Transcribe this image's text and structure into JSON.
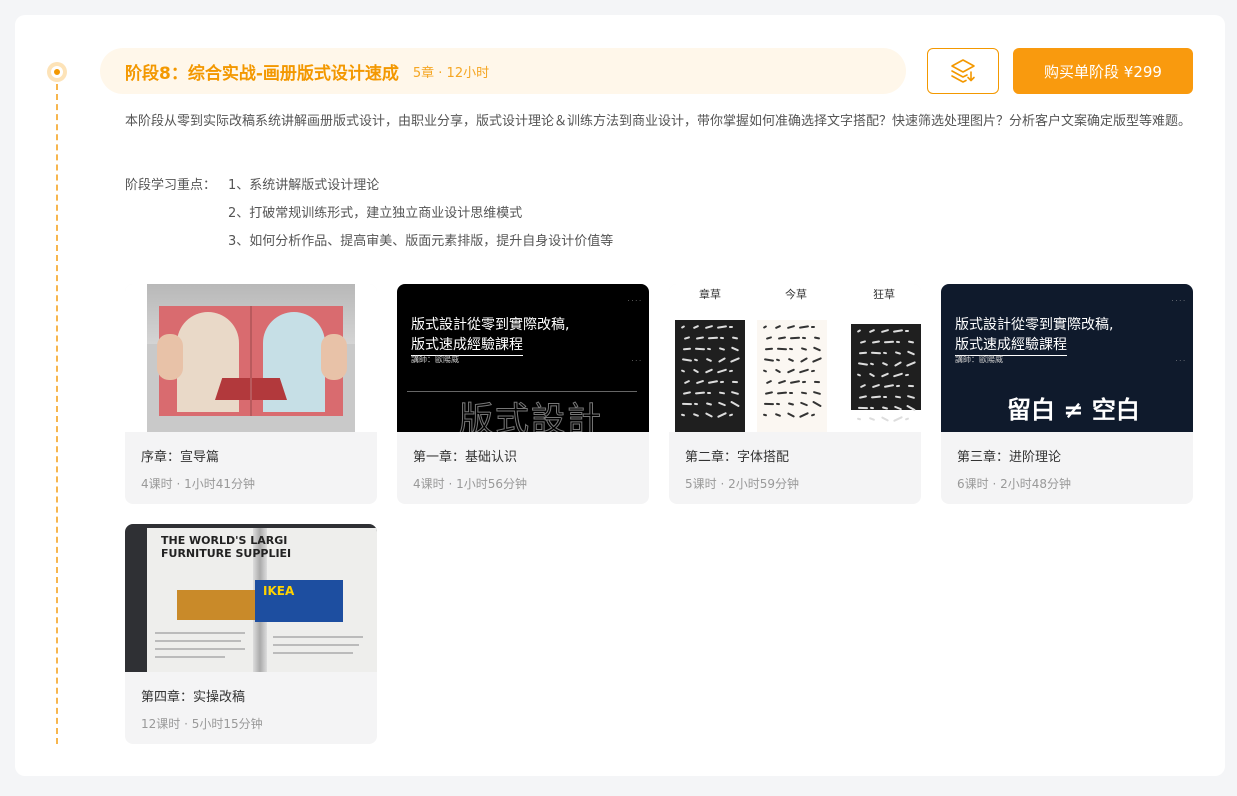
{
  "stage": {
    "title": "阶段8：综合实战-画册版式设计速成",
    "meta": "5章 · 12小时",
    "buy_label": "购买单阶段 ¥299",
    "layer_icon": "layers-download-icon",
    "description": "本阶段从零到实际改稿系统讲解画册版式设计，由职业分享，版式设计理论＆训练方法到商业设计，带你掌握如何准确选择文字搭配？快速筛选处理图片？分析客户文案确定版型等难题。",
    "focus_label": "阶段学习重点：",
    "focus_items": [
      "1、系统讲解版式设计理论",
      "2、打破常规训练形式，建立独立商业设计思维模式",
      "3、如何分析作品、提高审美、版面元素排版，提升自身设计价值等"
    ]
  },
  "chapters": [
    {
      "title": "序章：宣导篇",
      "meta": "4课时 · 1小时41分钟"
    },
    {
      "title": "第一章：基础认识",
      "meta": "4课时 · 1小时56分钟"
    },
    {
      "title": "第二章：字体搭配",
      "meta": "5课时 · 2小时59分钟"
    },
    {
      "title": "第三章：进阶理论",
      "meta": "6课时 · 2小时48分钟"
    },
    {
      "title": "第四章：实操改稿",
      "meta": "12课时 · 5小时15分钟"
    }
  ],
  "thumbs": {
    "slide_line1": "版式設計從零到實際改稿,",
    "slide_line2": "版式速成經驗課程",
    "slide_sub": "講師：歐陽威",
    "slide_big": "版式設計",
    "calligraphy_labels": [
      "章草",
      "今草",
      "狂草"
    ],
    "advanced_text": "留白 ≠ 空白",
    "catalog_headline": [
      "THE WORLD'S LARGI",
      "FURNITURE SUPPLIEI"
    ],
    "catalog_brand": "IKEA"
  },
  "colors": {
    "accent": "#f39800",
    "button": "#f99a0e"
  }
}
